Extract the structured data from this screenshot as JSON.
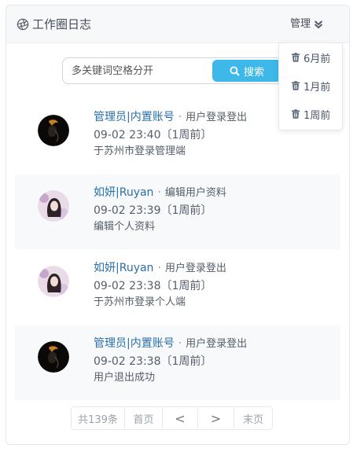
{
  "header": {
    "title": "工作圈日志",
    "manage_label": "管理",
    "icon": "aperture-icon"
  },
  "dropdown": {
    "items": [
      {
        "label": "6月前",
        "icon": "trash-icon"
      },
      {
        "label": "1月前",
        "icon": "trash-icon"
      },
      {
        "label": "1周前",
        "icon": "trash-icon"
      }
    ]
  },
  "search": {
    "placeholder": "多关键词空格分开",
    "button_label": "搜索"
  },
  "feed": [
    {
      "user": "管理员|内置账号",
      "action": "用户登录登出",
      "time": "09-02 23:40〔1周前〕",
      "detail": "于苏州市登录管理端",
      "avatar": "dark-avatar"
    },
    {
      "user": "如妍|Ruyan",
      "action": "编辑用户资料",
      "time": "09-02 23:39〔1周前〕",
      "detail": "编辑个人资料",
      "avatar": "girl-avatar"
    },
    {
      "user": "如妍|Ruyan",
      "action": "用户登录登出",
      "time": "09-02 23:38〔1周前〕",
      "detail": "于苏州市登录个人端",
      "avatar": "girl-avatar"
    },
    {
      "user": "管理员|内置账号",
      "action": "用户登录登出",
      "time": "09-02 23:38〔1周前〕",
      "detail": "用户退出成功",
      "avatar": "dark-avatar"
    }
  ],
  "pager": {
    "total": "共139条",
    "first": "首页",
    "prev": "<",
    "next": ">",
    "last": "末页"
  },
  "colors": {
    "accent": "#3db8e8",
    "username": "#2a6fa8",
    "text": "#555e69"
  }
}
